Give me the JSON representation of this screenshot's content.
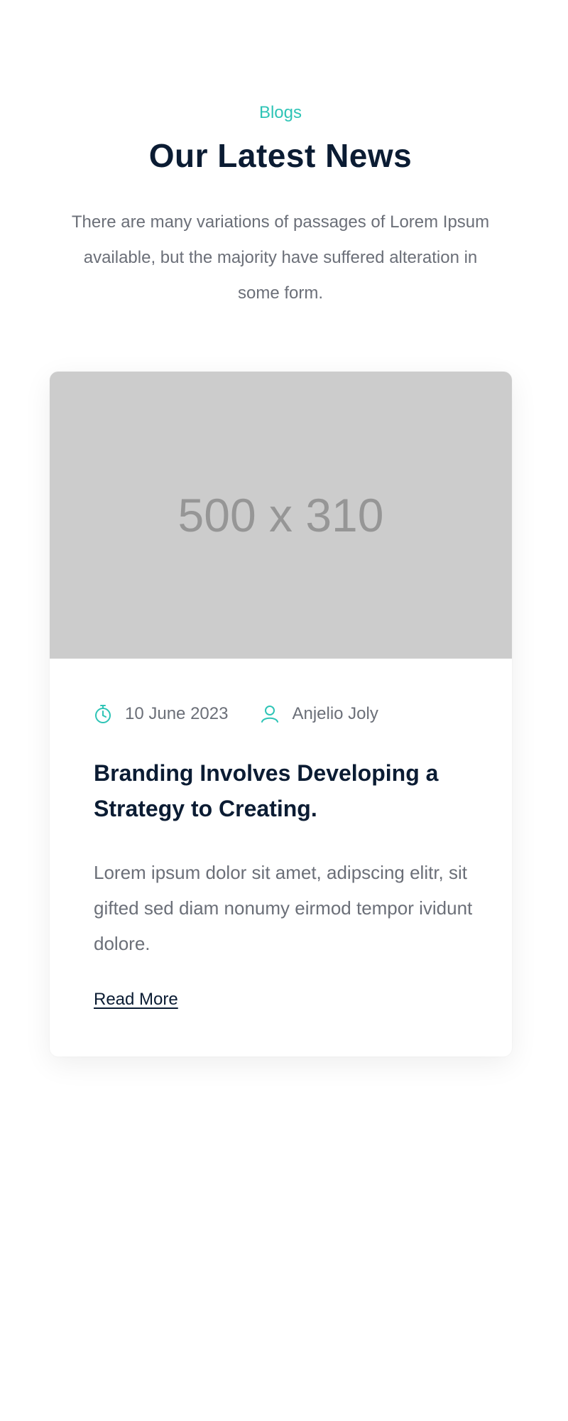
{
  "section": {
    "eyebrow": "Blogs",
    "title": "Our Latest News",
    "description": "There are many variations of passages of Lorem Ipsum available, but the majority have suffered alteration in some form."
  },
  "card": {
    "image_placeholder": "500 x 310",
    "date": "10 June 2023",
    "author": "Anjelio Joly",
    "title": "Branding Involves Developing a Strategy to Creating.",
    "excerpt": "Lorem ipsum dolor sit amet, adipscing elitr, sit gifted sed diam nonumy eirmod tempor ividunt dolore.",
    "read_more_label": "Read More",
    "date_icon": "stopwatch-icon",
    "author_icon": "user-icon"
  },
  "colors": {
    "accent": "#2ec4b6",
    "heading": "#0b1c33",
    "body_text": "#6b6f78",
    "placeholder_bg": "#cccccc",
    "placeholder_text": "#969696"
  }
}
